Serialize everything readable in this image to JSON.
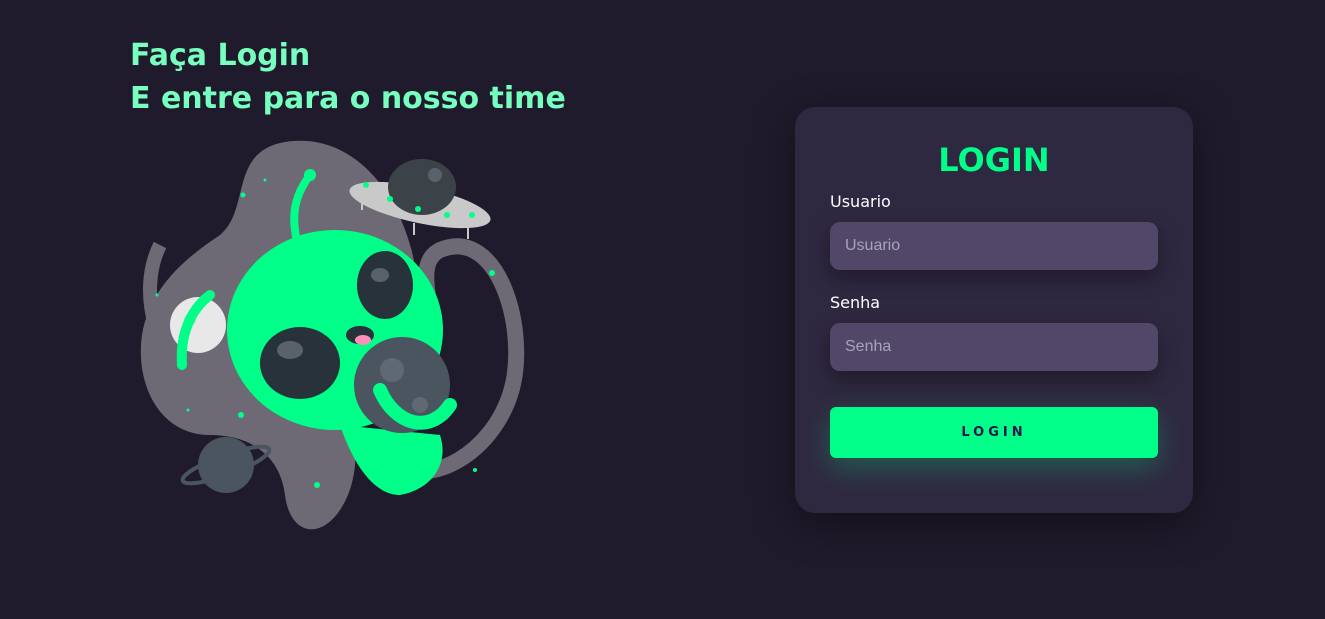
{
  "hero": {
    "line1": "Faça Login",
    "line2": "E entre para o nosso time"
  },
  "illustration": {
    "icon": "alien-astronaut-illustration",
    "description_colors": {
      "alien": "#00ff88",
      "blob": "#6e6a75",
      "planet": "#4b5560",
      "ufo": "#c9c9c9"
    }
  },
  "login_card": {
    "title": "LOGIN",
    "username": {
      "label": "Usuario",
      "placeholder": "Usuario",
      "value": ""
    },
    "password": {
      "label": "Senha",
      "placeholder": "Senha",
      "value": ""
    },
    "submit_label": "LOGIN"
  },
  "colors": {
    "background": "#201b2c",
    "card": "#2f2841",
    "input": "#514869",
    "accent": "#00ff88",
    "headline": "#77ffc0"
  }
}
